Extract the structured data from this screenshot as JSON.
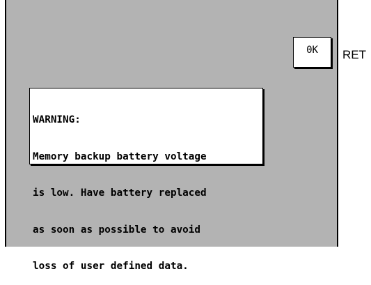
{
  "buttons": {
    "ok_label": "0K",
    "ret_label": "RET"
  },
  "warning": {
    "lines": [
      "WARNING:",
      "Memory backup battery voltage",
      "is low. Have battery replaced",
      "as soon as possible to avoid",
      "loss of user defined data."
    ]
  },
  "colors": {
    "screen_background": "#b3b3b3",
    "dialog_background": "#ffffff",
    "border": "#000000"
  }
}
